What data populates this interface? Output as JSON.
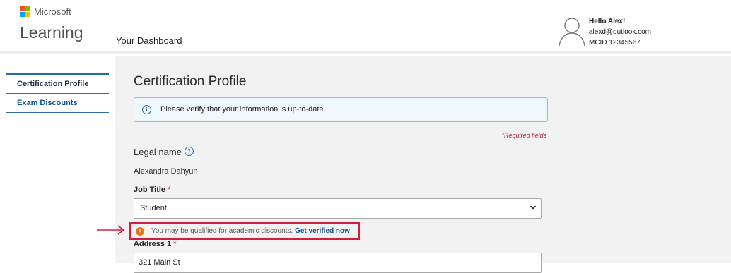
{
  "brand": {
    "company": "Microsoft",
    "app_title": "Learning",
    "logo_colors": [
      "#f25022",
      "#7fba00",
      "#00a4ef",
      "#ffb900"
    ]
  },
  "header": {
    "dashboard_link": "Your Dashboard"
  },
  "user": {
    "greeting": "Hello Alex!",
    "email": "alexd@outlook.com",
    "mcid": "MCID 12345567",
    "icon": "user-avatar-icon"
  },
  "sidebar": {
    "items": [
      {
        "label": "Certification Profile",
        "active": true
      },
      {
        "label": "Exam Discounts",
        "active": false
      }
    ]
  },
  "main": {
    "title": "Certification Profile",
    "info_banner": {
      "icon": "info-icon",
      "icon_glyph": "i",
      "text": "Please verify that your information is up-to-date."
    },
    "required_note": "*Required fields",
    "legal_name": {
      "label": "Legal name",
      "help_glyph": "?",
      "value": "Alexandra Dahyun"
    },
    "job_title": {
      "label": "Job Title",
      "required_mark": "*",
      "selected": "Student"
    },
    "academic_alert": {
      "icon": "warning-icon",
      "icon_glyph": "!",
      "text": "You may be qualified for academic discounts.",
      "link_text": "Get verified now"
    },
    "address1": {
      "label": "Address 1",
      "required_mark": "*",
      "value": "321 Main St"
    }
  },
  "colors": {
    "accent_blue": "#0f4f8c",
    "highlight_red": "#d21d3e",
    "warning_orange": "#e8711c",
    "info_border": "#8ac3d8"
  }
}
